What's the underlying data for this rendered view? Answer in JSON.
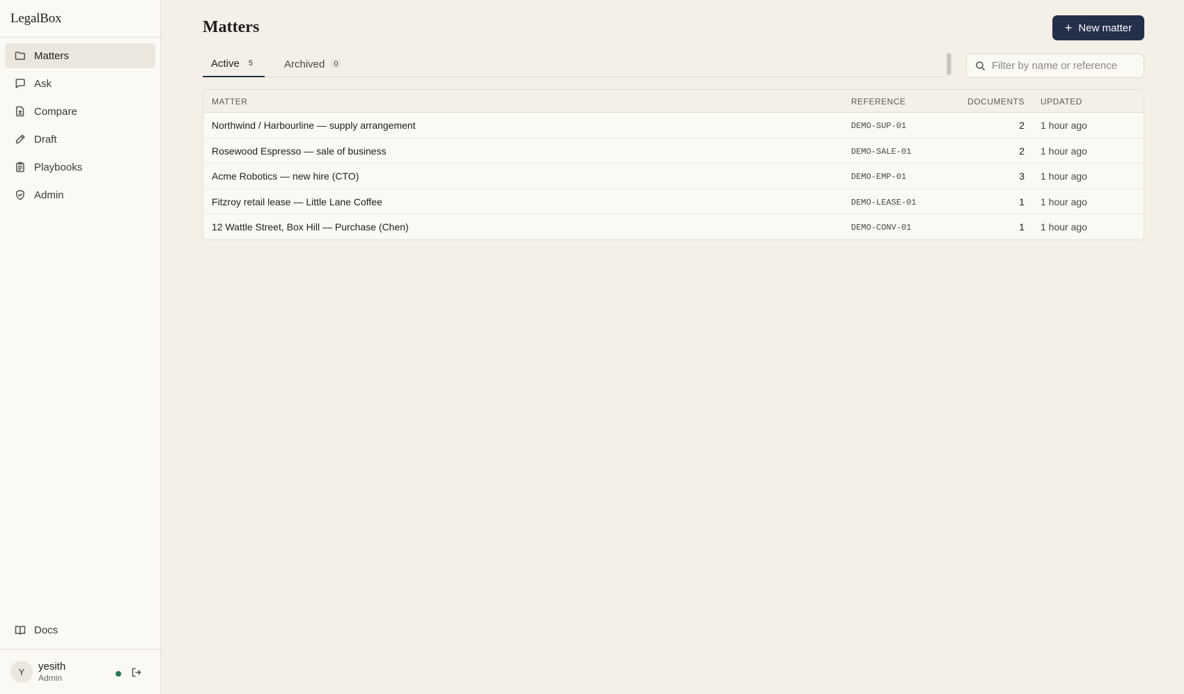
{
  "app": {
    "name": "LegalBox"
  },
  "sidebar": {
    "items": [
      {
        "label": "Matters",
        "icon": "folder-icon",
        "active": true
      },
      {
        "label": "Ask",
        "icon": "chat-icon"
      },
      {
        "label": "Compare",
        "icon": "document-compare-icon"
      },
      {
        "label": "Draft",
        "icon": "pen-icon"
      },
      {
        "label": "Playbooks",
        "icon": "clipboard-icon"
      },
      {
        "label": "Admin",
        "icon": "shield-icon"
      }
    ],
    "docs": {
      "label": "Docs",
      "icon": "book-icon"
    },
    "user": {
      "initial": "Y",
      "name": "yesith",
      "role": "Admin",
      "status_color": "#1f7a4d"
    }
  },
  "main": {
    "title": "Matters",
    "new_button": {
      "label": "New matter",
      "icon": "plus-icon"
    },
    "tabs": [
      {
        "label": "Active",
        "count": "5",
        "active": true
      },
      {
        "label": "Archived",
        "count": "0"
      }
    ],
    "search": {
      "placeholder": "Filter by name or reference",
      "value": ""
    },
    "table": {
      "columns": {
        "matter": "MATTER",
        "reference": "REFERENCE",
        "documents": "DOCUMENTS",
        "updated": "UPDATED"
      },
      "rows": [
        {
          "matter": "Northwind / Harbourline — supply arrangement",
          "reference": "DEMO-SUP-01",
          "documents": "2",
          "updated": "1 hour ago"
        },
        {
          "matter": "Rosewood Espresso — sale of business",
          "reference": "DEMO-SALE-01",
          "documents": "2",
          "updated": "1 hour ago"
        },
        {
          "matter": "Acme Robotics — new hire (CTO)",
          "reference": "DEMO-EMP-01",
          "documents": "3",
          "updated": "1 hour ago"
        },
        {
          "matter": "Fitzroy retail lease — Little Lane Coffee",
          "reference": "DEMO-LEASE-01",
          "documents": "1",
          "updated": "1 hour ago"
        },
        {
          "matter": "12 Wattle Street, Box Hill — Purchase (Chen)",
          "reference": "DEMO-CONV-01",
          "documents": "1",
          "updated": "1 hour ago"
        }
      ]
    }
  },
  "colors": {
    "accent": "#24304a",
    "background": "#f4f0e7",
    "sidebar": "#fbf9f4"
  }
}
